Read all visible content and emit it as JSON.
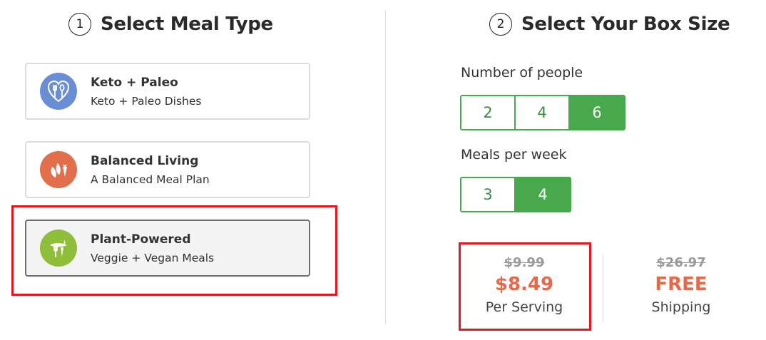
{
  "meal_section": {
    "step_number": "1",
    "title": "Select Meal Type",
    "cards": [
      {
        "title": "Keto + Paleo",
        "subtitle": "Keto + Paleo Dishes",
        "icon": "fork-spoon-heart-icon",
        "color": "#6a8ed6"
      },
      {
        "title": "Balanced Living",
        "subtitle": "A Balanced Meal Plan",
        "icon": "vegetables-icon",
        "color": "#e26e4c"
      },
      {
        "title": "Plant-Powered",
        "subtitle": "Veggie + Vegan Meals",
        "icon": "plant-fork-icon",
        "color": "#8fbe3a",
        "selected": true
      }
    ]
  },
  "box_section": {
    "step_number": "2",
    "title": "Select Your Box Size",
    "people_label": "Number of people",
    "people_options": [
      "2",
      "4",
      "6"
    ],
    "people_selected": "6",
    "meals_label": "Meals per week",
    "meals_options": [
      "3",
      "4"
    ],
    "meals_selected": "4"
  },
  "pricing": {
    "serving": {
      "old": "$9.99",
      "new": "$8.49",
      "caption": "Per Serving"
    },
    "shipping": {
      "old": "$26.97",
      "new": "FREE",
      "caption": "Shipping"
    }
  },
  "colors": {
    "accent_green": "#47a84c",
    "price_orange": "#e8684a",
    "highlight_red": "#e8161c"
  }
}
